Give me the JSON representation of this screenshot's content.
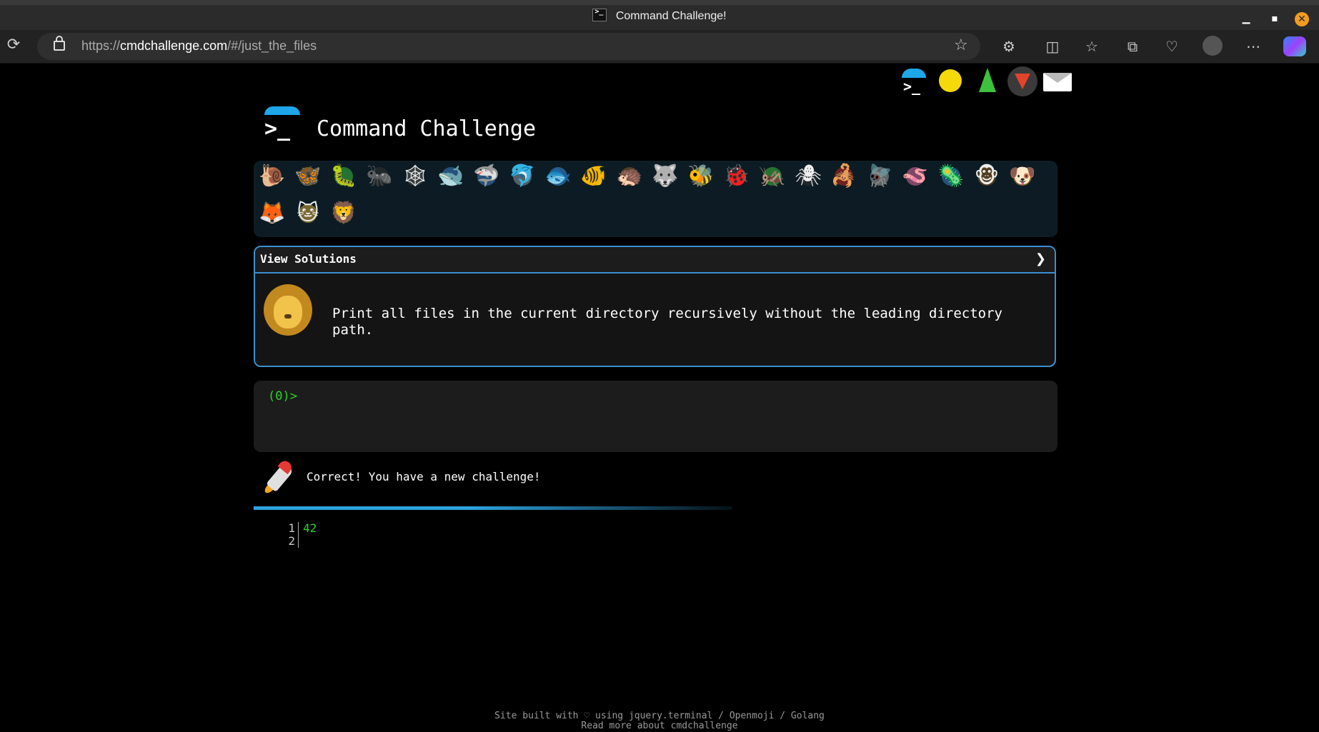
{
  "browser": {
    "tab_title": "Command Challenge!",
    "url_prefix": "https://",
    "url_host": "cmdchallenge.com",
    "url_path": "/#/just_the_files",
    "window_controls": [
      "minimize",
      "maximize",
      "close"
    ],
    "toolbar_icons": [
      "extensions-icon",
      "split-screen-icon",
      "favorites-icon",
      "collections-icon",
      "browser-essentials-icon",
      "profile-avatar",
      "more-icon",
      "copilot-icon"
    ]
  },
  "header": {
    "social_icons": [
      "cmdchallenge-logo-icon",
      "face-icon",
      "tree-icon",
      "gitlab-icon",
      "mail-icon"
    ],
    "title": "Command Challenge"
  },
  "challenge_icons": [
    {
      "name": "snail",
      "glyph": "🐌",
      "color": "#b5853a"
    },
    {
      "name": "butterfly",
      "glyph": "🦋",
      "color": "#e08a1a"
    },
    {
      "name": "caterpillar",
      "glyph": "🐛",
      "color": "#3cba3c"
    },
    {
      "name": "ant",
      "glyph": "🐜",
      "color": "#333333"
    },
    {
      "name": "spider-web",
      "glyph": "🕸",
      "color": "#555555"
    },
    {
      "name": "whale",
      "glyph": "🐋",
      "color": "#3b7fc4"
    },
    {
      "name": "shark",
      "glyph": "🦈",
      "color": "#3b7fc4"
    },
    {
      "name": "dolphin",
      "glyph": "🐬",
      "color": "#8a9aa8"
    },
    {
      "name": "fish",
      "glyph": "🐟",
      "color": "#3b8fe0"
    },
    {
      "name": "tropical-fish",
      "glyph": "🐠",
      "color": "#f2c01e"
    },
    {
      "name": "hedgehog",
      "glyph": "🦔",
      "color": "#8a5a20"
    },
    {
      "name": "wolf",
      "glyph": "🐺",
      "color": "#8a8a8a"
    },
    {
      "name": "bee",
      "glyph": "🐝",
      "color": "#e5d21a"
    },
    {
      "name": "ladybug",
      "glyph": "🐞",
      "color": "#e53935"
    },
    {
      "name": "cricket",
      "glyph": "🦗",
      "color": "#3cba3c"
    },
    {
      "name": "spider",
      "glyph": "🕷",
      "color": "#333333"
    },
    {
      "name": "scorpion",
      "glyph": "🦂",
      "color": "#c0281e"
    },
    {
      "name": "fly",
      "glyph": "🪰",
      "color": "#9aa0a6"
    },
    {
      "name": "worm",
      "glyph": "🪱",
      "color": "#e06aa0"
    },
    {
      "name": "microbe",
      "glyph": "🦠",
      "color": "#3b7fc4"
    },
    {
      "name": "monkey",
      "glyph": "🐵",
      "color": "#8a5a20"
    },
    {
      "name": "dog",
      "glyph": "🐶",
      "color": "#d49a2a"
    },
    {
      "name": "fox",
      "glyph": "🦊",
      "color": "#e07020"
    },
    {
      "name": "cat",
      "glyph": "🐱",
      "color": "#d4a83a"
    },
    {
      "name": "lion",
      "glyph": "🦁",
      "color": "#e0a020"
    }
  ],
  "solutions": {
    "label": "View Solutions",
    "chevron": "❯",
    "challenge_text": "Print all files in the current directory recursively without the leading directory path."
  },
  "terminal": {
    "prompt": "(0)>"
  },
  "result": {
    "message": "Correct! You have a new challenge!"
  },
  "output": {
    "lines": [
      {
        "number": "1",
        "text": "42"
      },
      {
        "number": "2",
        "text": ""
      }
    ]
  },
  "footer": {
    "line1": "Site built with ♡ using jquery.terminal / Openmoji / Golang",
    "line2": "Read more about cmdchallenge"
  },
  "colors": {
    "accent": "#1ea6e8",
    "prompt_green": "#2bd42b",
    "panel_bg": "#0d1c24",
    "border_blue": "#3a8fcf"
  }
}
